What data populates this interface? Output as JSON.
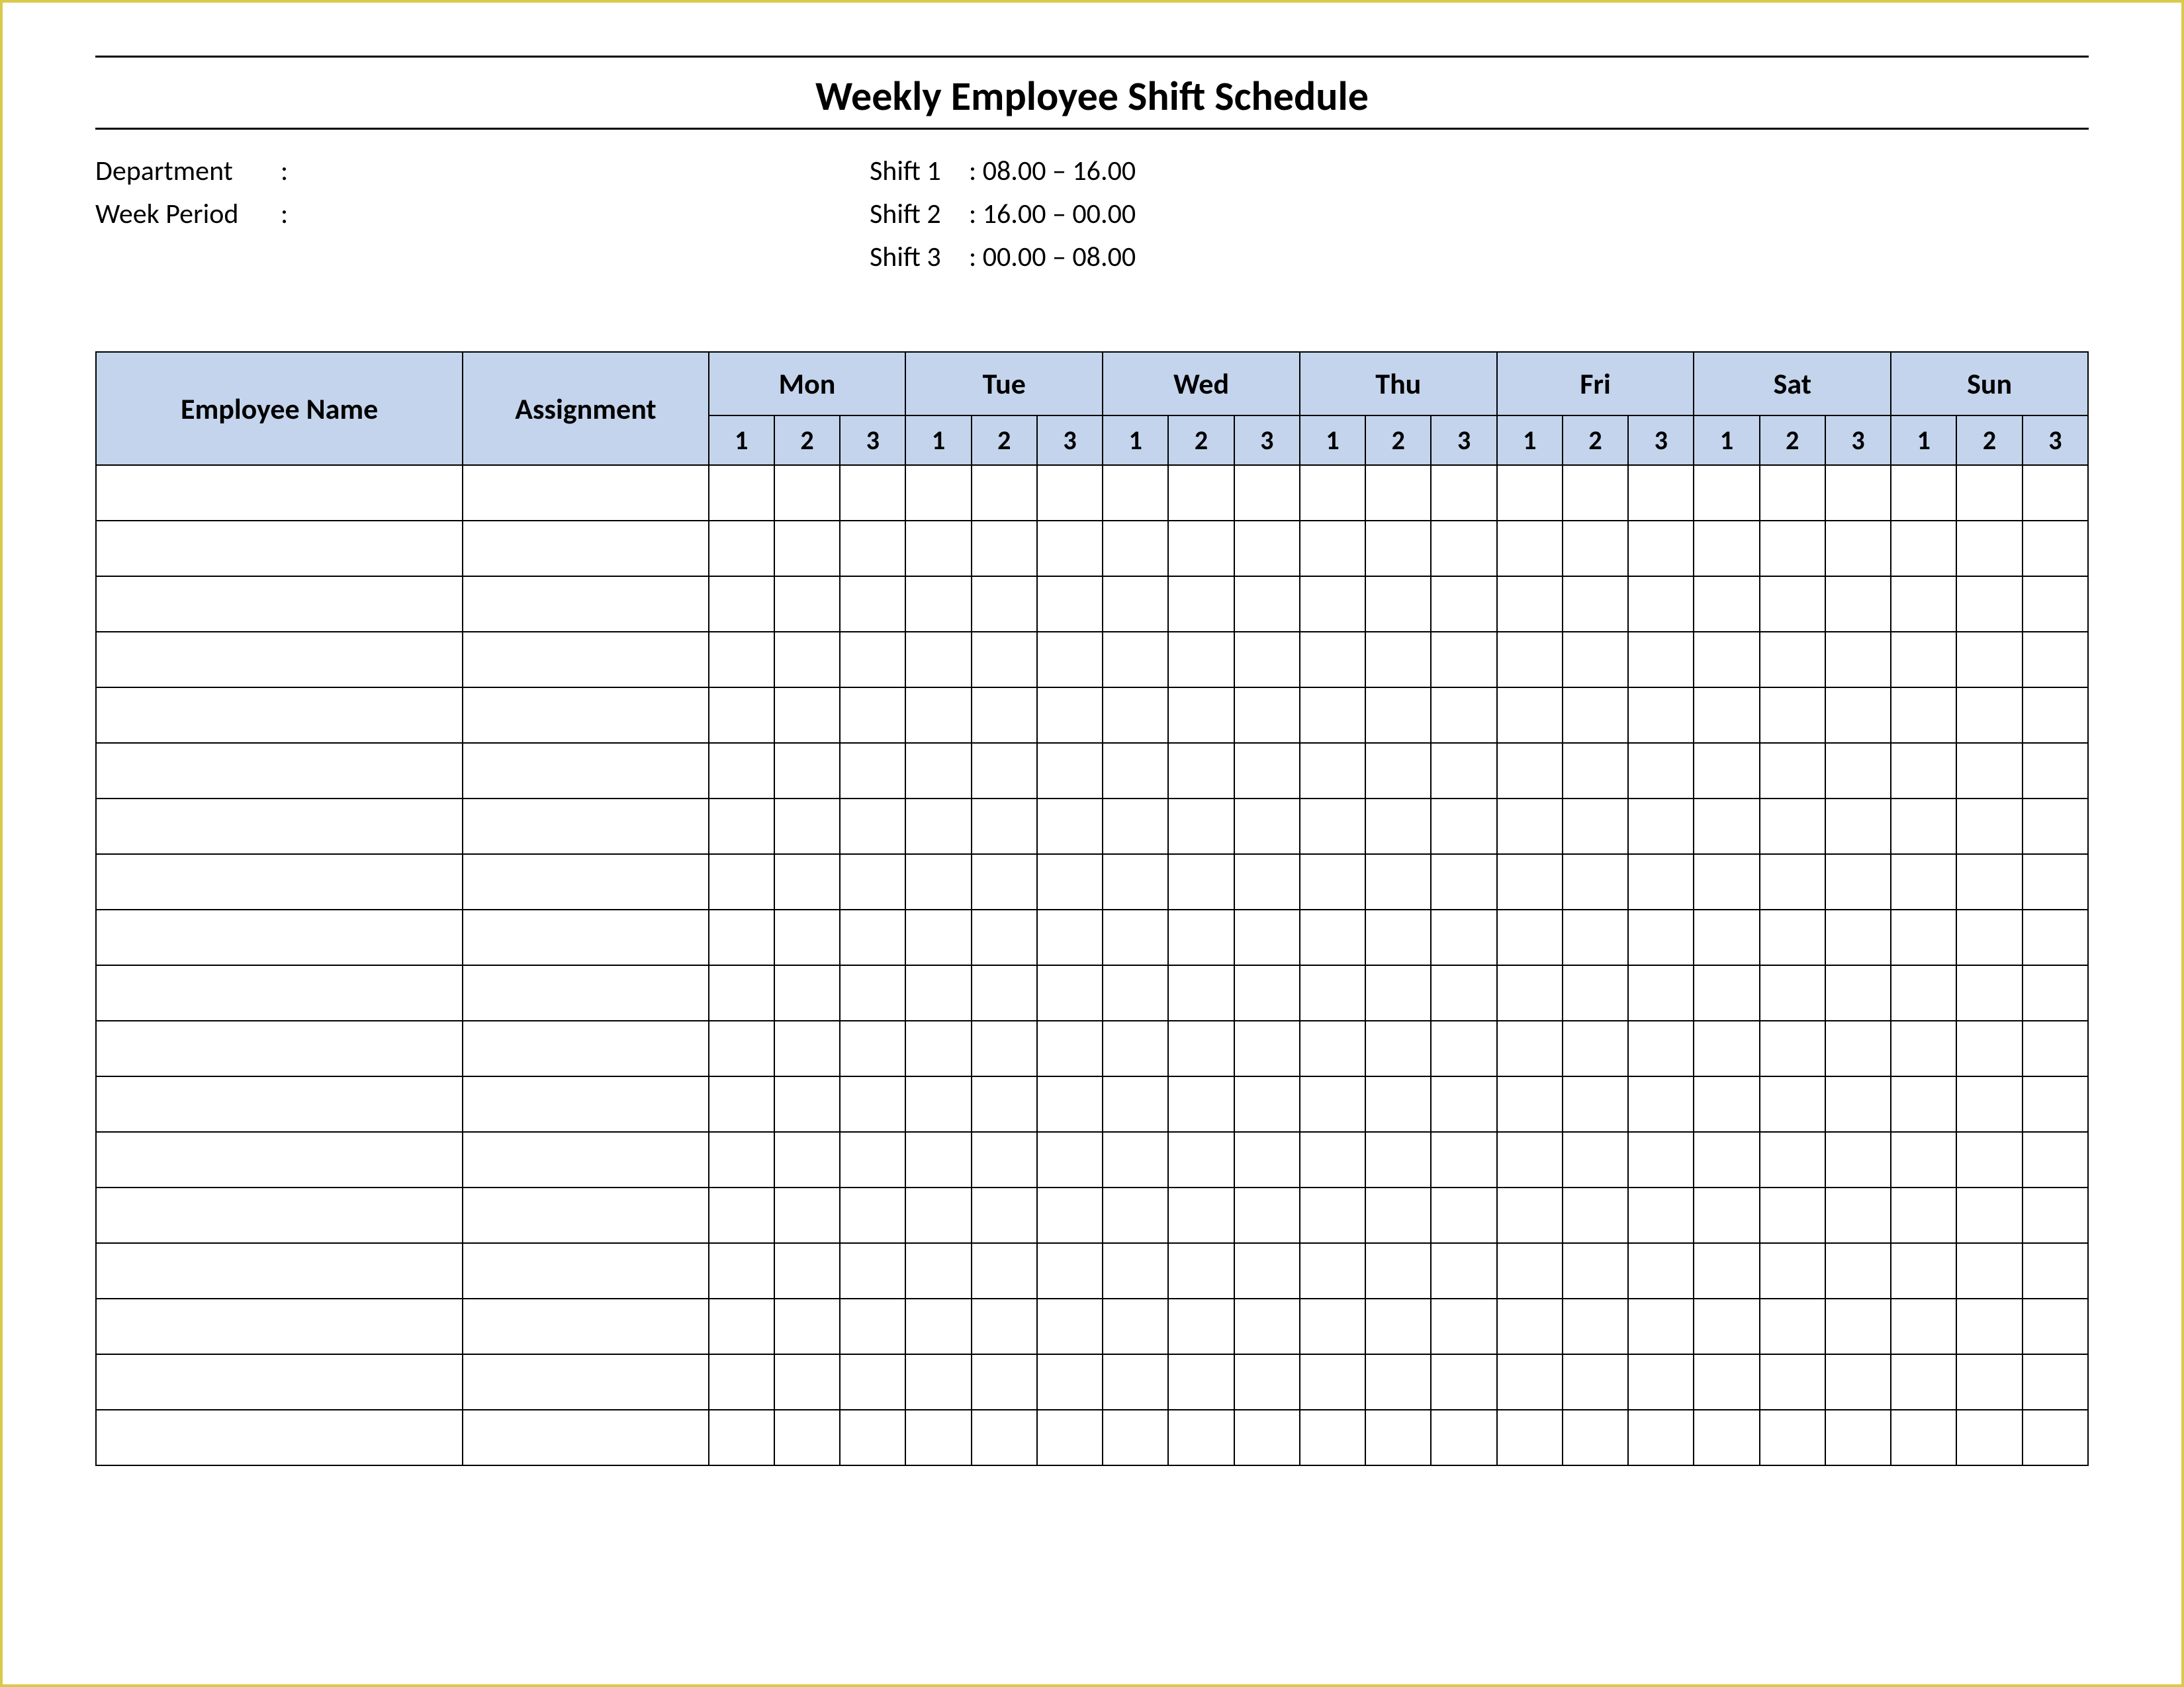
{
  "title": "Weekly Employee Shift Schedule",
  "info": {
    "department_label": "Department",
    "department_value": "",
    "week_period_label": "Week  Period",
    "week_period_value": "",
    "shifts": [
      {
        "label": "Shift 1",
        "range": "08.00  – 16.00"
      },
      {
        "label": "Shift 2",
        "range": "16.00  – 00.00"
      },
      {
        "label": "Shift 3",
        "range": "00.00  – 08.00"
      }
    ]
  },
  "table": {
    "headers": {
      "employee": "Employee Name",
      "assignment": "Assignment",
      "days": [
        "Mon",
        "Tue",
        "Wed",
        "Thu",
        "Fri",
        "Sat",
        "Sun"
      ],
      "shifts": [
        "1",
        "2",
        "3"
      ]
    },
    "empty_rows": 18
  }
}
